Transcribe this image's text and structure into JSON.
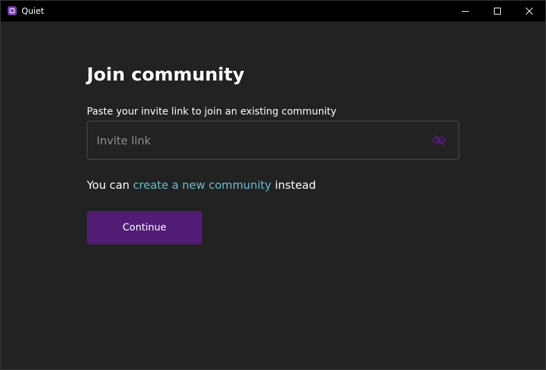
{
  "window": {
    "title": "Quiet"
  },
  "page": {
    "heading": "Join community",
    "field_label": "Paste your invite link to join an existing community",
    "invite_input": {
      "value": "",
      "placeholder": "Invite link"
    },
    "helper": {
      "prefix": "You can ",
      "link_text": "create a new community",
      "suffix": " instead"
    },
    "continue_label": "Continue"
  },
  "icons": {
    "app": "quiet-logo-icon",
    "visibility": "eye-off-icon"
  },
  "colors": {
    "background": "#222222",
    "titlebar": "#000000",
    "primary_button": "#521c74",
    "link": "#67bfd3",
    "visibility_icon": "#521c74",
    "text": "#ffffff",
    "placeholder": "#8f8f8f"
  }
}
